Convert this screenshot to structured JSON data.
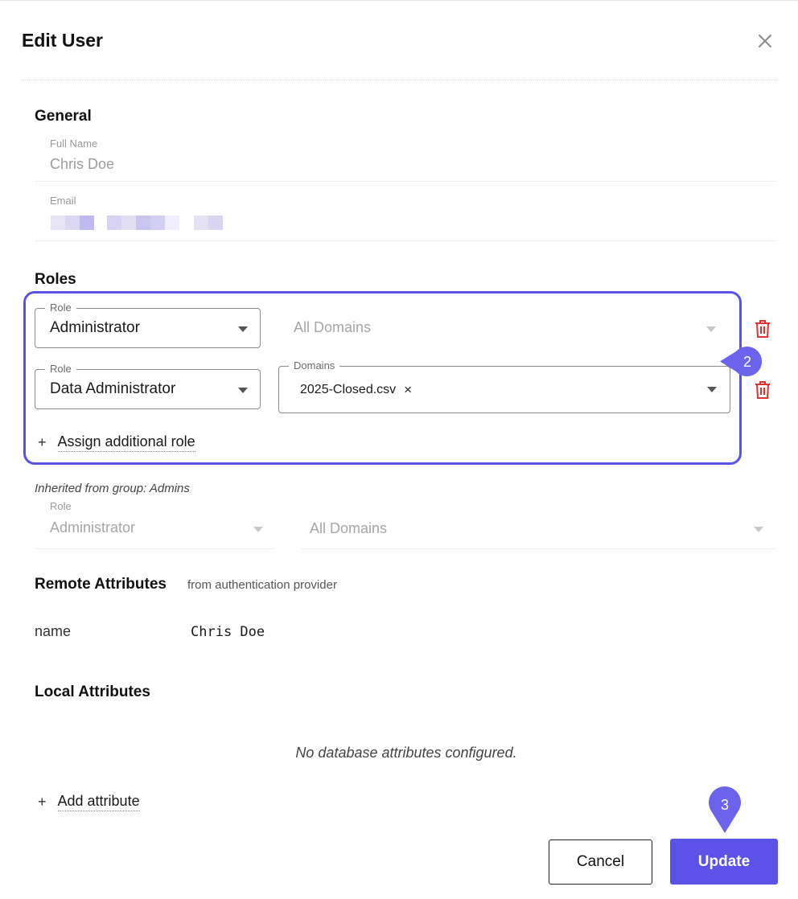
{
  "dialog": {
    "title": "Edit User"
  },
  "general": {
    "title": "General",
    "full_name_label": "Full Name",
    "full_name_value": "Chris Doe",
    "email_label": "Email"
  },
  "roles": {
    "title": "Roles",
    "items": [
      {
        "role_label": "Role",
        "role_value": "Administrator",
        "domains_placeholder": "All Domains"
      },
      {
        "role_label": "Role",
        "role_value": "Data Administrator",
        "domains_label": "Domains",
        "domain_chip": "2025-Closed.csv",
        "chip_remove": "×"
      }
    ],
    "assign_plus": "+",
    "assign_label": "Assign additional role"
  },
  "inherited": {
    "label": "Inherited from group: Admins",
    "role_label": "Role",
    "role_value": "Administrator",
    "domains_value": "All Domains"
  },
  "remote": {
    "title": "Remote Attributes",
    "subtitle": "from authentication provider",
    "rows": [
      {
        "name": "name",
        "value": "Chris Doe"
      }
    ]
  },
  "local": {
    "title": "Local Attributes",
    "empty_message": "No database attributes configured.",
    "add_plus": "+",
    "add_label": "Add attribute"
  },
  "annotations": {
    "step2": "2",
    "step3": "3"
  },
  "footer": {
    "cancel_label": "Cancel",
    "update_label": "Update"
  },
  "colors": {
    "accent": "#5b52e8",
    "danger": "#e03131"
  }
}
